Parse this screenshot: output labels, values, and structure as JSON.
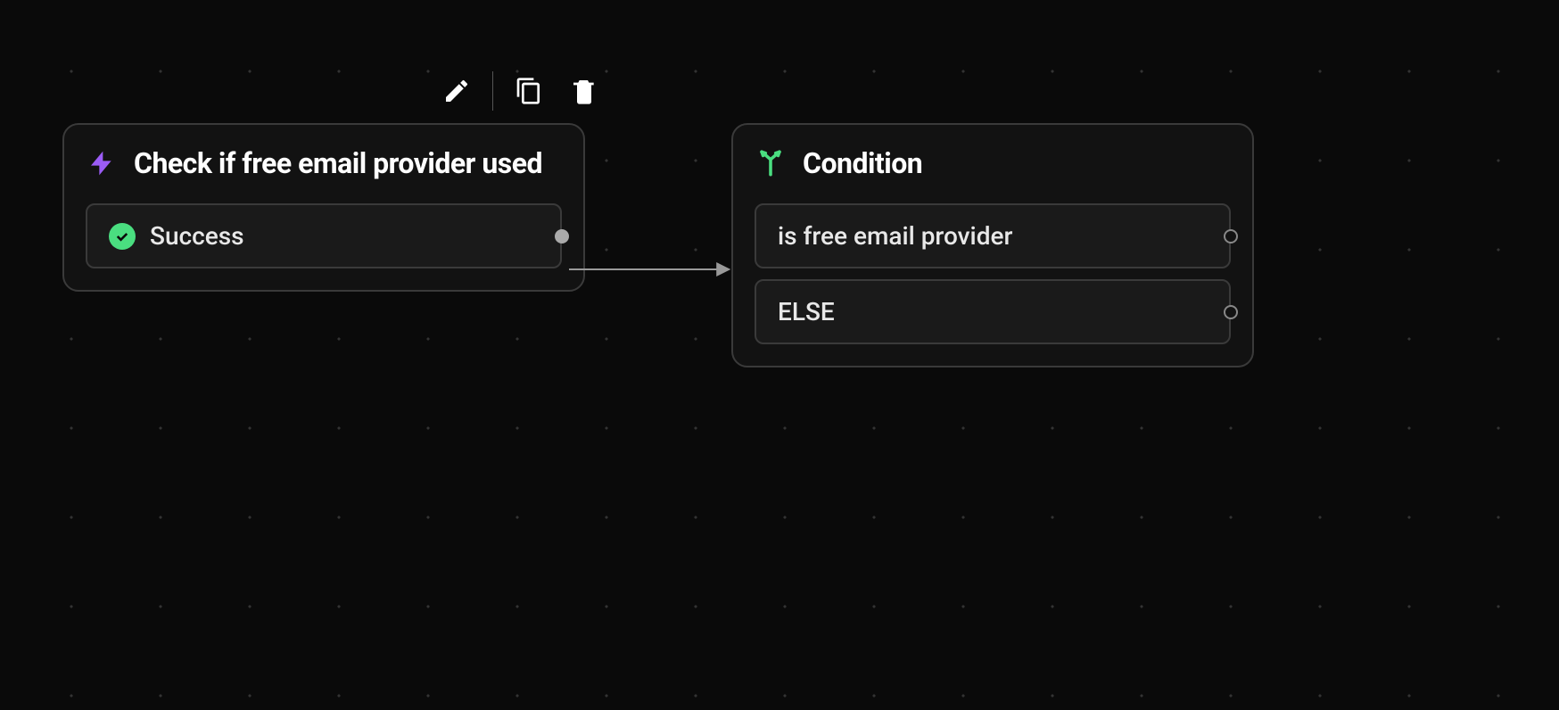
{
  "nodes": {
    "action": {
      "title": "Check if free email provider used",
      "slots": [
        {
          "label": "Success"
        }
      ]
    },
    "condition": {
      "title": "Condition",
      "slots": [
        {
          "label": "is free email provider"
        },
        {
          "label": "ELSE"
        }
      ]
    }
  },
  "colors": {
    "lightning": "#9b5cf6",
    "branch": "#4ade80"
  }
}
